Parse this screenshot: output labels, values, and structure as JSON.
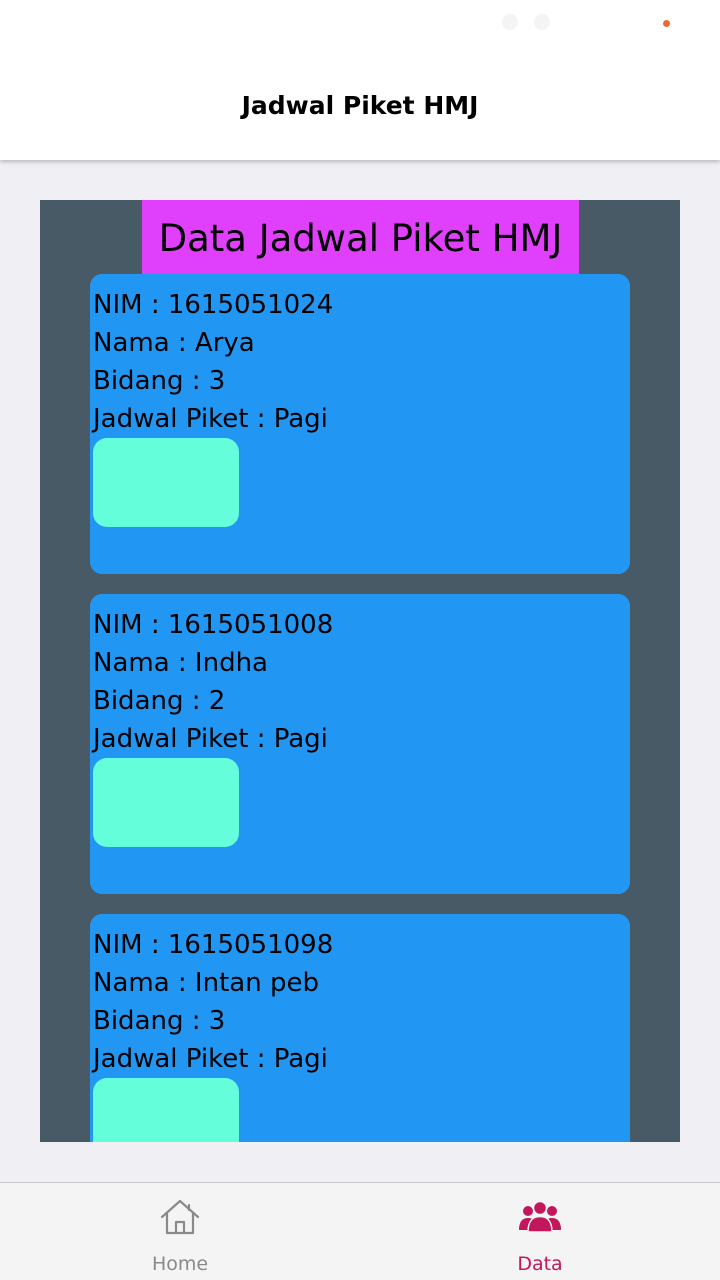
{
  "header": {
    "title": "Jadwal Piket HMJ"
  },
  "panel": {
    "title": "Data Jadwal Piket HMJ"
  },
  "records": [
    {
      "nim": "NIM : 1615051024",
      "nama": "Nama : Arya",
      "bidang": "Bidang : 3",
      "jadwal": "Jadwal Piket : Pagi"
    },
    {
      "nim": "NIM : 1615051008",
      "nama": "Nama : Indha",
      "bidang": "Bidang : 2",
      "jadwal": "Jadwal Piket : Pagi"
    },
    {
      "nim": "NIM : 1615051098",
      "nama": "Nama : Intan peb",
      "bidang": "Bidang : 3",
      "jadwal": "Jadwal Piket : Pagi"
    }
  ],
  "tabs": [
    {
      "label": "Home",
      "icon": "home-icon",
      "active": false
    },
    {
      "label": "Data",
      "icon": "people-icon",
      "active": true
    }
  ],
  "colors": {
    "panel_bg": "#475a65",
    "title_bg": "#e040fb",
    "card_bg": "#2196f3",
    "card_button": "#64ffda",
    "active_tab": "#c2185b",
    "inactive_tab": "#8a8a8a"
  }
}
